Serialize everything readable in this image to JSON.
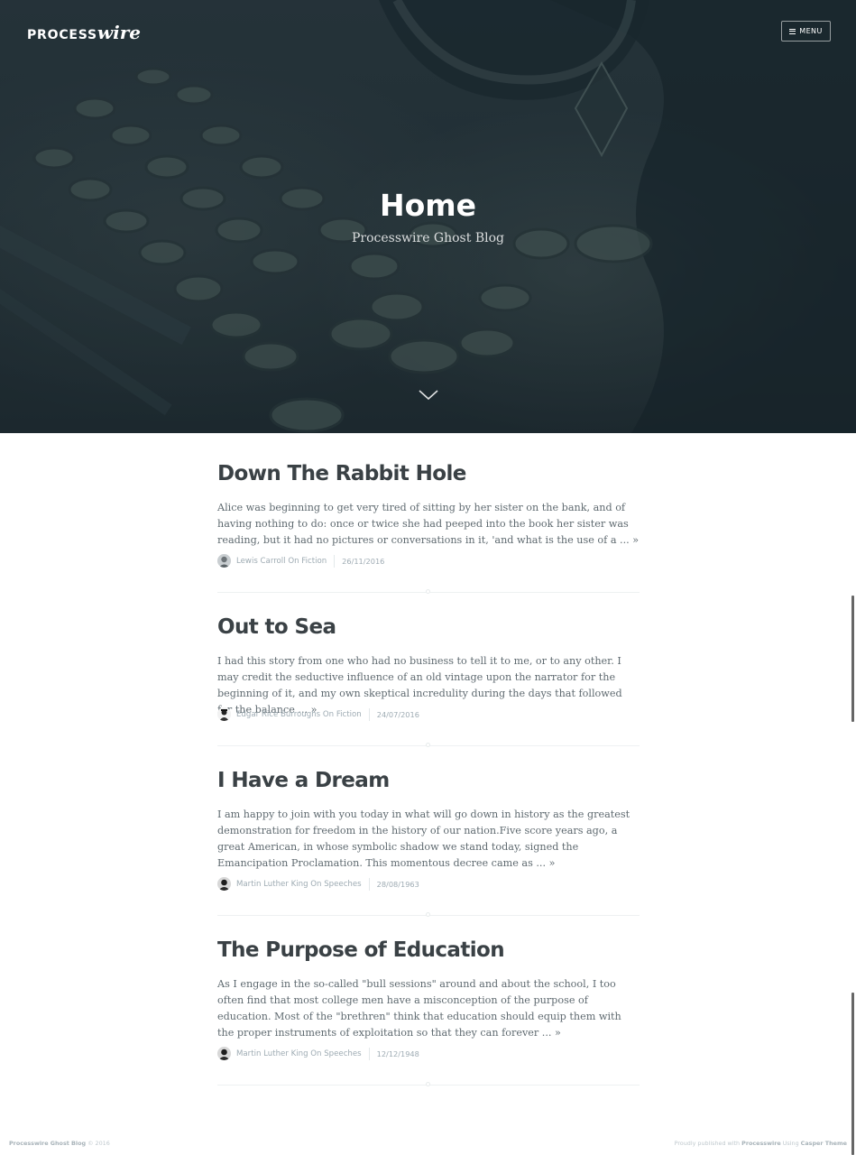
{
  "header": {
    "logo_text_1": "PROCESS",
    "logo_text_2": "wire",
    "menu_label": "MENU"
  },
  "hero": {
    "title": "Home",
    "subtitle": "Processwire Ghost Blog"
  },
  "posts": [
    {
      "title": "Down The Rabbit Hole",
      "excerpt": "Alice was beginning to get very tired of sitting by her sister on the bank, and of having nothing to do: once or twice she had peeped into the book her sister was reading, but it had no pictures or conversations in it, 'and what is the use of a ...",
      "more": "»",
      "author": "Lewis Carroll",
      "tag_prefix": "On",
      "tag": "Fiction",
      "date": "26/11/2016"
    },
    {
      "title": "Out to Sea",
      "excerpt": "I had this story from one who had no business to tell it to me, or to any other. I may credit the seductive influence of an old vintage upon the narrator for the beginning of it, and my own skeptical incredulity during the days that followed for the balance ...",
      "more": "»",
      "author": "Edgar Rice Burroughs",
      "tag_prefix": "On",
      "tag": "Fiction",
      "date": "24/07/2016"
    },
    {
      "title": "I Have a Dream",
      "excerpt": "I am happy to join with you today in what will go down in history as the greatest demonstration for freedom in the history of our nation.Five score years ago, a great American, in whose symbolic shadow we stand today, signed the Emancipation Proclamation. This momentous decree came as ...",
      "more": "»",
      "author": "Martin Luther King",
      "tag_prefix": "On",
      "tag": "Speeches",
      "date": "28/08/1963"
    },
    {
      "title": "The Purpose of Education",
      "excerpt": "As I engage in the so-called \"bull sessions\" around and about the school, I too often find that most college men have a misconception of the purpose of education. Most of the \"brethren\" think that education should equip them with the proper instruments of exploitation so that they can forever ...",
      "more": "»",
      "author": "Martin Luther King",
      "tag_prefix": "On",
      "tag": "Speeches",
      "date": "12/12/1948"
    }
  ],
  "footer": {
    "blog_name": "Processwire Ghost Blog",
    "copyright": "© 2016",
    "credit_1": "Proudly published with",
    "credit_link_1": "Processwire",
    "credit_2": "Using",
    "credit_link_2": "Casper Theme"
  }
}
